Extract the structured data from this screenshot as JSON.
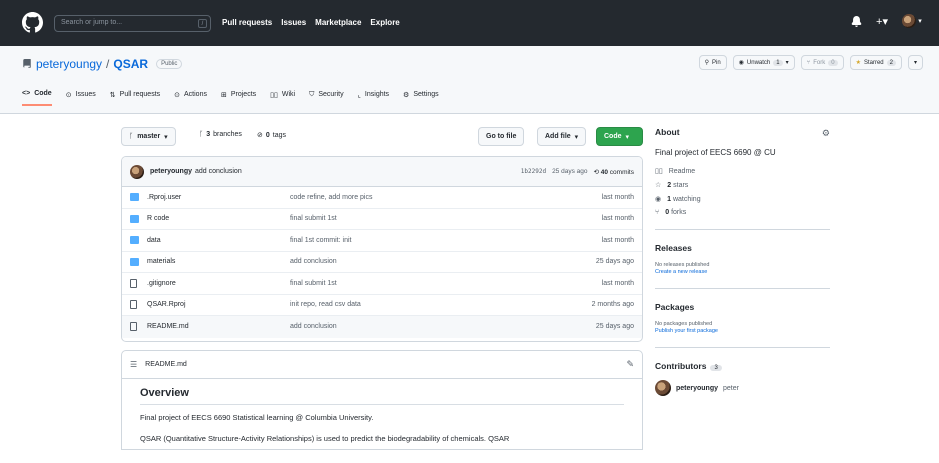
{
  "topbar": {
    "search_placeholder": "Search or jump to...",
    "search_shortcut": "/",
    "nav": [
      "Pull requests",
      "Issues",
      "Marketplace",
      "Explore"
    ]
  },
  "repo": {
    "owner": "peteryoungy",
    "separator": "/",
    "name": "QSAR",
    "visibility": "Public",
    "pin_label": "Pin",
    "unwatch_label": "Unwatch",
    "watch_count": "1",
    "fork_label": "Fork",
    "fork_count": "0",
    "starred_label": "Starred",
    "star_count": "2"
  },
  "tabs": [
    "Code",
    "Issues",
    "Pull requests",
    "Actions",
    "Projects",
    "Wiki",
    "Security",
    "Insights",
    "Settings"
  ],
  "branch": {
    "name": "master",
    "branches_count": "3",
    "branches_label": "branches",
    "tags_count": "0",
    "tags_label": "tags",
    "go_to_file": "Go to file",
    "add_file": "Add file",
    "code": "Code"
  },
  "latest_commit": {
    "user": "peteryoungy",
    "message": "add conclusion",
    "hash": "1b2292d",
    "time": "25 days ago",
    "commits_count": "40",
    "commits_label": "commits"
  },
  "files": [
    {
      "type": "dir",
      "name": ".Rproj.user",
      "message": "code refine, add more pics",
      "time": "last month"
    },
    {
      "type": "dir",
      "name": "R code",
      "message": "final submit 1st",
      "time": "last month"
    },
    {
      "type": "dir",
      "name": "data",
      "message": "final 1st commit: init",
      "time": "last month"
    },
    {
      "type": "dir",
      "name": "materials",
      "message": "add conclusion",
      "time": "25 days ago"
    },
    {
      "type": "file",
      "name": ".gitignore",
      "message": "final submit 1st",
      "time": "last month"
    },
    {
      "type": "file",
      "name": "QSAR.Rproj",
      "message": "init repo, read csv data",
      "time": "2 months ago"
    },
    {
      "type": "file",
      "name": "README.md",
      "message": "add conclusion",
      "time": "25 days ago"
    }
  ],
  "readme": {
    "filename": "README.md",
    "heading": "Overview",
    "p1": "Final project of EECS 6690 Statistical learning @ Columbia University.",
    "p2": "QSAR (Quantitative Structure-Activity Relationships) is used to predict the biodegradability of chemicals. QSAR"
  },
  "about": {
    "title": "About",
    "description": "Final project of EECS 6690 @ CU",
    "readme": "Readme",
    "stars_count": "2",
    "stars_label": "stars",
    "watching_count": "1",
    "watching_label": "watching",
    "forks_count": "0",
    "forks_label": "forks"
  },
  "releases": {
    "title": "Releases",
    "empty": "No releases published",
    "link": "Create a new release"
  },
  "packages": {
    "title": "Packages",
    "empty": "No packages published",
    "link": "Publish your first package"
  },
  "contributors": {
    "title": "Contributors",
    "count": "3",
    "first_user": "peteryoungy",
    "first_name": "peter"
  },
  "colors": {
    "header_bg": "#24292f",
    "link": "#0969da",
    "green": "#2da44e",
    "folder": "#54aeff",
    "active_tab": "#fd8c73"
  }
}
